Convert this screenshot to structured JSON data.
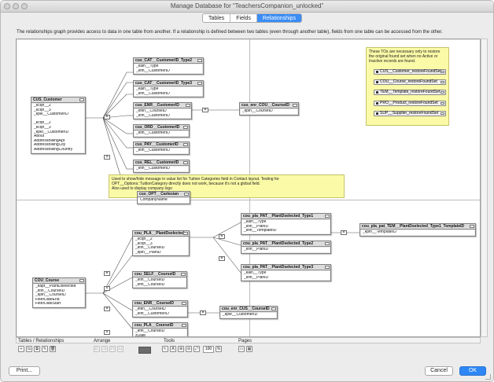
{
  "window": {
    "title": "Manage Database for “TeachersCompanion_unlocked”"
  },
  "tabs": [
    {
      "label": "Tables"
    },
    {
      "label": "Fields"
    },
    {
      "label": "Relationships"
    }
  ],
  "description": "The relationships graph provides access to data in one table from another. If a relationship is defined between two tables (even through another table), fields from one table can be accessed from the other.",
  "tables": {
    "cus_customer": {
      "name": "CUS_Customer",
      "fields": [
        "_kcqn__2",
        "_kcqn__3",
        "_kplk__CustomerID",
        "",
        "_kcqn__2",
        "_kcqn__3",
        "_kpkt__CustomerID",
        "About",
        "AddressBillingApt",
        "AddressBillingCity",
        "AddressBillingCountry"
      ]
    },
    "cat_type2": {
      "name": "cus_CAT__CustomerID_Type2",
      "fields": [
        "_kaln__Type",
        "_kfln__CustomerID"
      ]
    },
    "cat_type3": {
      "name": "cus_CAT__CustomerID_Type3",
      "fields": [
        "_kaln__Type",
        "_kfln__CustomerID"
      ]
    },
    "cus_enr": {
      "name": "cus_ENR__CustomerID",
      "fields": [
        "_kfkn__CourseID",
        "_kfln__CustomerID"
      ]
    },
    "cus_enr_cou": {
      "name": "cus_enr_COU__CourseID",
      "fields": [
        "_kpln__CourseID"
      ]
    },
    "cus_ord": {
      "name": "cus_ORD__CustomerID",
      "fields": [
        "_kfln__CustomerID"
      ]
    },
    "cus_pay": {
      "name": "cus_PAY__CustomerID",
      "fields": [
        "_kfln__CustomerID"
      ]
    },
    "cus_rel": {
      "name": "cus_REL__CustomerID",
      "fields": [
        "_kfln__CustomerID"
      ]
    },
    "cus_opt": {
      "name": "cus_OPT__Cartesian",
      "fields": [
        "CompanyName"
      ]
    },
    "cou_pla": {
      "name": "cou_PLA__PlantDselected",
      "fields": [
        "_kcqn__2",
        "_kcqn__3",
        "_kfln__CourseID",
        "_kpln__PlanID"
      ]
    },
    "pla_pat1": {
      "name": "cou_pla_PAT__PlantDselected_Type1",
      "fields": [
        "_kaln__Type",
        "_kfln__PlanID",
        "_kfln__TemplateID"
      ]
    },
    "pla_pat_tem": {
      "name": "cou_pla_pat_TEM__PlantDselected_Type1_TemplateID",
      "fields": [
        "_kpln__TemplateID"
      ]
    },
    "pla_pat2": {
      "name": "cou_pla_PAT__PlantDselected_Type2",
      "fields": [
        "_kfln__PlanID"
      ]
    },
    "pla_pat3": {
      "name": "cou_pla_PAT__PlantDselected_Type3",
      "fields": [
        "_kaln__Type",
        "_kfln__PlanID"
      ]
    },
    "cou_course": {
      "name": "COU_Course",
      "fields": [
        "_kapt__PlantDselected",
        "_kfln__CourseID",
        "_kpln__CourseID",
        "FilterDateEnd",
        "FilterDateStart"
      ]
    },
    "cou_self": {
      "name": "cou_SELF__CourseID",
      "fields": [
        "_kfln__CourseID",
        "_kfln__CourseID"
      ]
    },
    "cou_enr": {
      "name": "cou_ENR__CourseID",
      "fields": [
        "_kfkn__CourseID",
        "_kfln__CustomerID"
      ]
    },
    "cou_enr_cus": {
      "name": "cou_enr_CUS__CourseID",
      "fields": [
        "_kple__CustomerID"
      ]
    },
    "cou_pla2": {
      "name": "cou_PLA__CourseID",
      "fields": [
        "_kfln__CourseID",
        "zDate"
      ]
    }
  },
  "notes": {
    "restore_note": "These TOs are necessary only to restore the original found set when no Active or Inactive records are found.",
    "restore_items": [
      "CUS__Customer_restoreFoundSet",
      "COU__Course_restoreFoundSet",
      "TEM__Template_restoreFoundSet",
      "PRO__Product_restoreFoundSet",
      "SUP__Supplier_restoreFoundSet"
    ],
    "tuition_note_1": "Used to show/hide message in value list for Tuition Categories field in Contact layout. Testing for",
    "tuition_note_2": "OPT__Options::TuitionCategory directly does not work, because it's not a global field.",
    "tuition_note_3": "Also used to display company logo"
  },
  "toolbar": {
    "groups": [
      "Tables / Relationships",
      "Arrange",
      "Tools",
      "Pages"
    ],
    "zoom": "100"
  },
  "buttons": {
    "print": "Print...",
    "cancel": "Cancel",
    "ok": "OK"
  }
}
